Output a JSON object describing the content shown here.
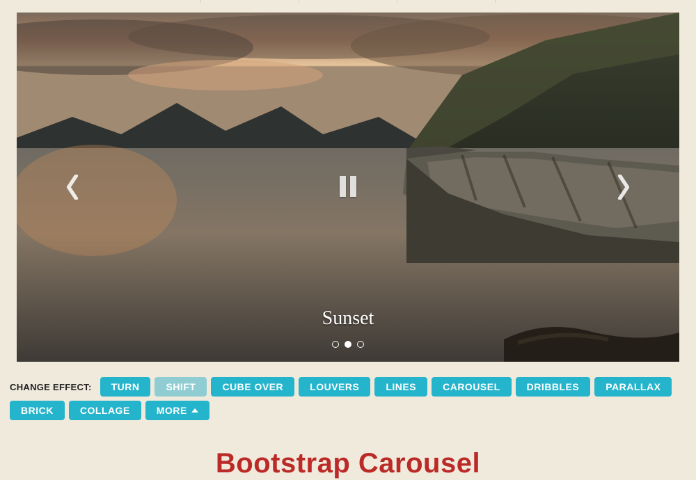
{
  "carousel": {
    "caption": "Sunset",
    "slide_count": 3,
    "active_index": 1,
    "prev_label": "Previous",
    "next_label": "Next",
    "pause_label": "Pause"
  },
  "effects": {
    "label": "CHANGE EFFECT:",
    "selected": "SHIFT",
    "buttons": [
      "TURN",
      "SHIFT",
      "CUBE OVER",
      "LOUVERS",
      "LINES",
      "CAROUSEL",
      "DRIBBLES",
      "PARALLAX",
      "BRICK",
      "COLLAGE"
    ],
    "more_label": "MORE"
  },
  "page": {
    "title": "Bootstrap Carousel"
  }
}
